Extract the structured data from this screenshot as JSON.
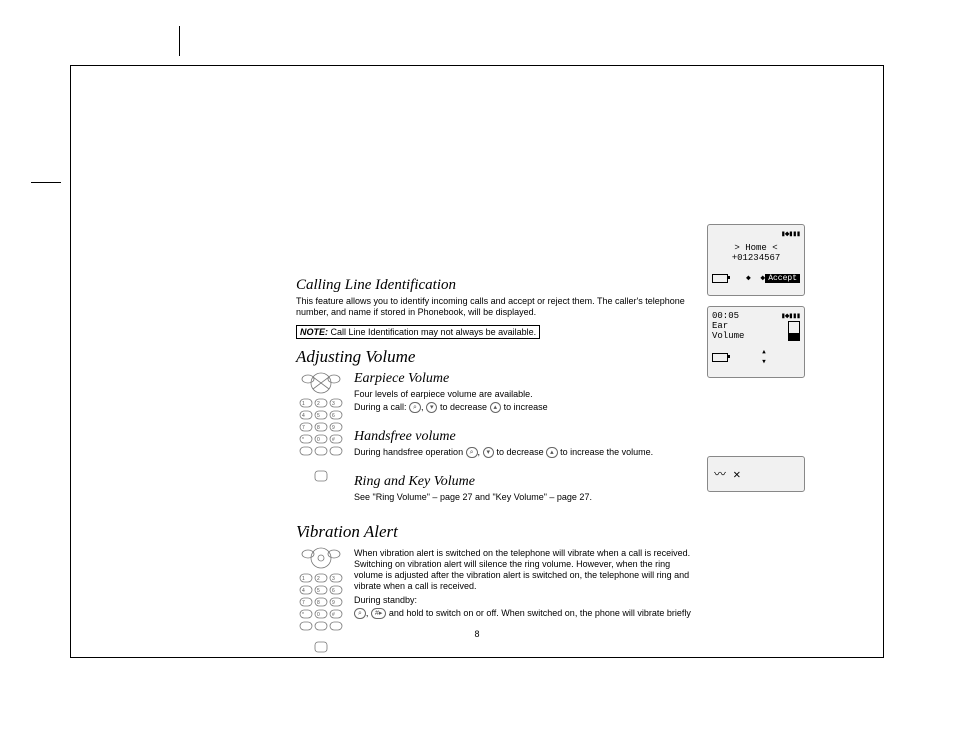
{
  "page_number": "8",
  "sections": {
    "cli": {
      "title": "Calling Line Identification",
      "body": "This feature allows you to identify incoming calls and accept or reject them. The caller's telephone number, and name if stored in Phonebook, will be displayed.",
      "note_label": "NOTE:",
      "note_text": " Call Line Identification may not always be available."
    },
    "adjust": {
      "title": "Adjusting Volume",
      "earpiece": {
        "title": "Earpiece Volume",
        "line1": "Four levels of earpiece volume are available.",
        "line2_a": "During a call: ",
        "line2_b": " to decrease ",
        "line2_c": " to increase"
      },
      "handsfree": {
        "title": "Handsfree volume",
        "line_a": "During handsfree operation ",
        "line_b": " to decrease ",
        "line_c": " to increase the volume."
      },
      "ringkey": {
        "title": "Ring and Key Volume",
        "line": "See \"Ring Volume\" – page 27 and \"Key Volume\" – page 27."
      }
    },
    "vibration": {
      "title": "Vibration Alert",
      "para": "When vibration alert is switched on the telephone will vibrate when a call is received. Switching on vibration alert will silence the ring volume. However, when the ring volume is adjusted after the vibration alert is switched on, the telephone will ring and vibrate when a call is received.",
      "standby": "During standby:",
      "instr_a": "",
      "instr_b": " and hold to switch on or off. When switched on, the phone will vibrate briefly"
    }
  },
  "screens": {
    "caller": {
      "signal": "▮◆▮▮▮",
      "home": "Home",
      "number": "+01234567",
      "accept": "Accept"
    },
    "volume": {
      "time": "00:05",
      "signal": "▮◆▮▮▮",
      "line1": "Ear",
      "line2": "Volume"
    }
  }
}
